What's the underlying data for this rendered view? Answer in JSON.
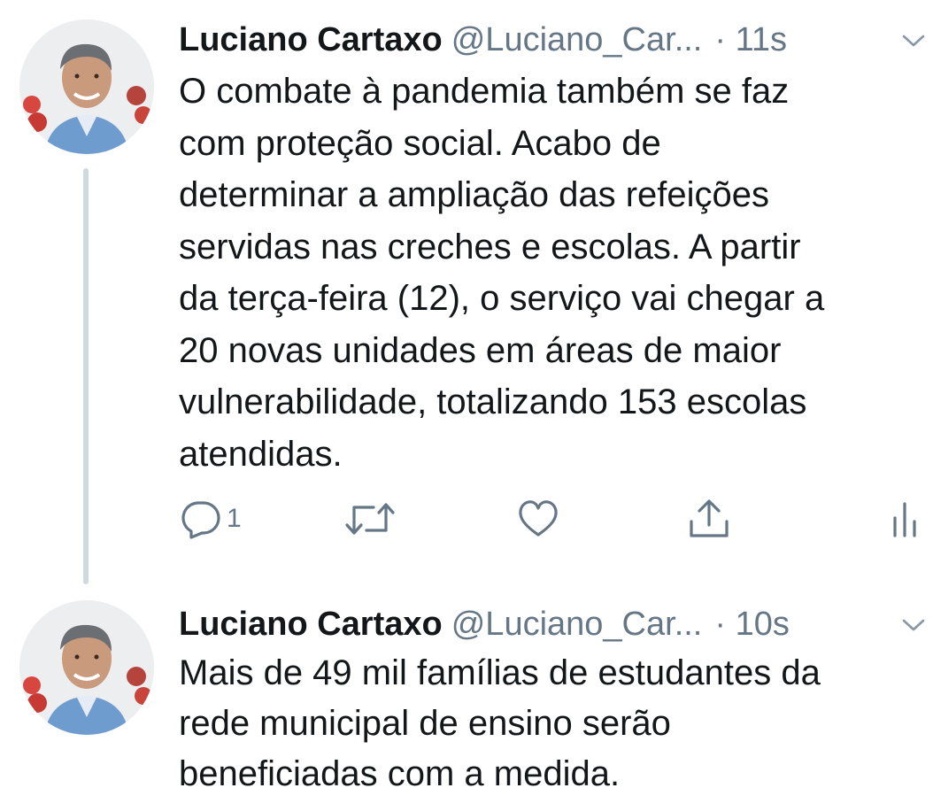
{
  "tweets": [
    {
      "author_name": "Luciano Cartaxo",
      "author_handle": "@Luciano_Car...",
      "timestamp": "· 11s",
      "text": "O combate à pandemia também se faz\ncom proteção social. Acabo de\ndeterminar a ampliação das refeições\nservidas nas creches e escolas. A partir\nda terça-feira (12), o serviço vai chegar a\n20 novas unidades em áreas de maior\nvulnerabilidade, totalizando 153 escolas\natendidas.",
      "reply_count": "1",
      "icons": [
        "reply-icon",
        "retweet-icon",
        "like-icon",
        "share-icon",
        "analytics-icon"
      ]
    },
    {
      "author_name": "Luciano Cartaxo",
      "author_handle": "@Luciano_Car...",
      "timestamp": "· 10s",
      "text": "Mais de 49 mil famílias de estudantes da\nrede municipal de ensino serão\nbeneficiadas com a medida."
    }
  ],
  "colors": {
    "text_primary": "#14171a",
    "text_secondary": "#657786",
    "thread_line": "#cfd9de"
  }
}
